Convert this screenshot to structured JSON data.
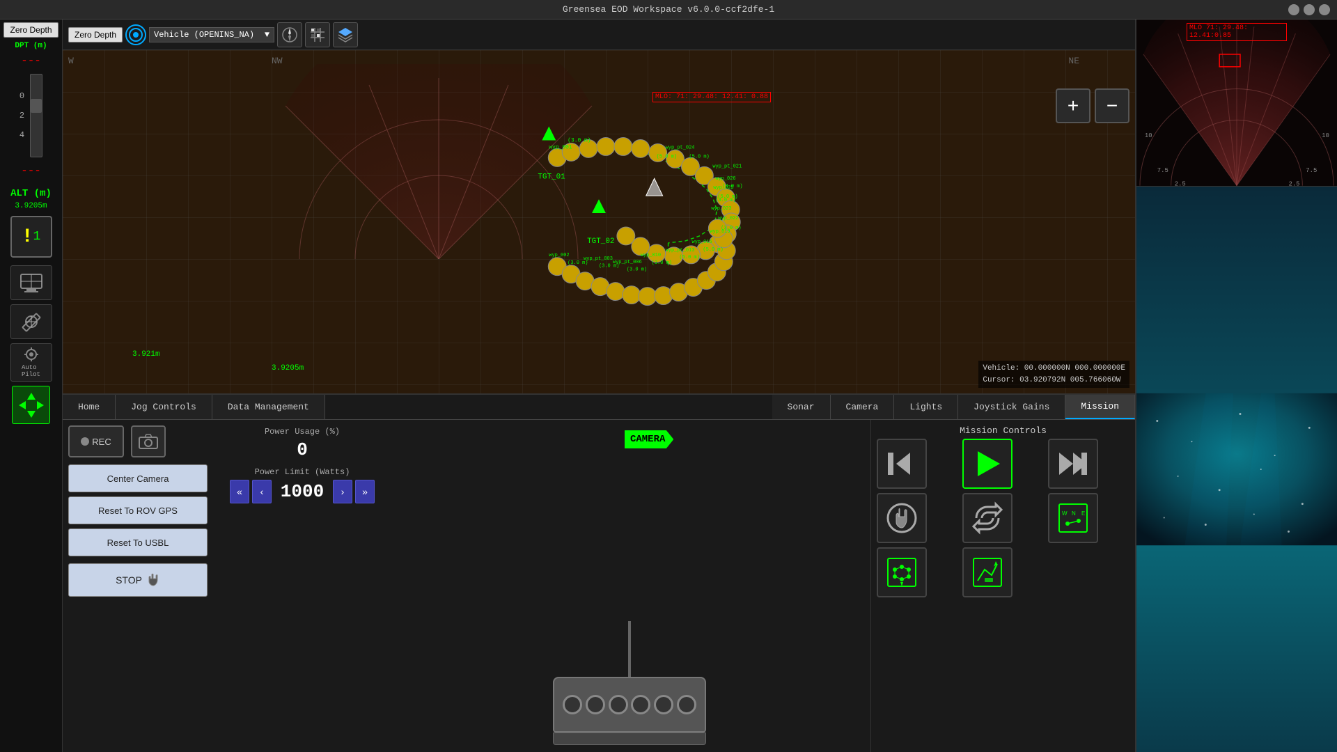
{
  "titlebar": {
    "title": "Greensea EOD Workspace v6.0.0-ccf2dfe-1",
    "min": "─",
    "max": "□",
    "close": "✕"
  },
  "left_sidebar": {
    "depth_zero_label": "Zero Depth",
    "dpt_label": "DPT (m)",
    "alt_label": "ALT (m)",
    "dash": "---",
    "scale_0": "0",
    "scale_2": "2",
    "scale_4": "4"
  },
  "toolbar": {
    "depth_zero": "Zero Depth",
    "vehicle_name": "Vehicle (OPENINS_NA)",
    "zoom_plus": "+",
    "zoom_minus": "−"
  },
  "map": {
    "compass_w": "W",
    "compass_nw": "NW",
    "compass_ne": "NE",
    "mlo_label": "MLO: 71: 29.48: 12.41: 0.88",
    "tgt_01": "TGT_01",
    "tgt_02": "TGT_02",
    "vehicle_coords": "Vehicle: 00.000000N 000.000000E",
    "cursor_coords": "Cursor: 03.920792N 005.766060W",
    "scale_dist": "3.921m",
    "scale_dist2": "3.9205m"
  },
  "tabs": [
    {
      "id": "home",
      "label": "Home"
    },
    {
      "id": "jog",
      "label": "Jog Controls"
    },
    {
      "id": "data",
      "label": "Data Management"
    },
    {
      "id": "sonar",
      "label": "Sonar"
    },
    {
      "id": "camera",
      "label": "Camera"
    },
    {
      "id": "lights",
      "label": "Lights"
    },
    {
      "id": "joystick",
      "label": "Joystick Gains"
    },
    {
      "id": "mission",
      "label": "Mission"
    }
  ],
  "active_tab": "Mission",
  "camera_controls": {
    "rec_label": "●REC",
    "power_usage_label": "Power Usage (%)",
    "power_usage_value": "0",
    "power_limit_label": "Power Limit (Watts)",
    "power_limit_value": "1000",
    "center_camera": "Center Camera",
    "reset_rov_gps": "Reset To ROV GPS",
    "reset_usbl": "Reset To USBL",
    "stop_label": "STOP"
  },
  "mission_controls": {
    "title": "Mission Controls",
    "btn_rewind_label": "rewind",
    "btn_play_label": "play",
    "btn_forward_label": "fast-forward",
    "btn_stop_label": "stop-hand",
    "btn_repeat_label": "repeat",
    "btn_map_label": "compass-map",
    "btn_waypoint_label": "waypoint-grid",
    "btn_route_label": "route-arrow"
  },
  "sonar_panel": {
    "mlo_label": "MLO 71: 29.48: 12.41:0.85"
  },
  "colors": {
    "accent_green": "#00ff00",
    "accent_red": "#ff0000",
    "accent_blue": "#00aaff",
    "bg_dark": "#1a1a1a",
    "tab_active_bg": "#3a3a3a"
  }
}
